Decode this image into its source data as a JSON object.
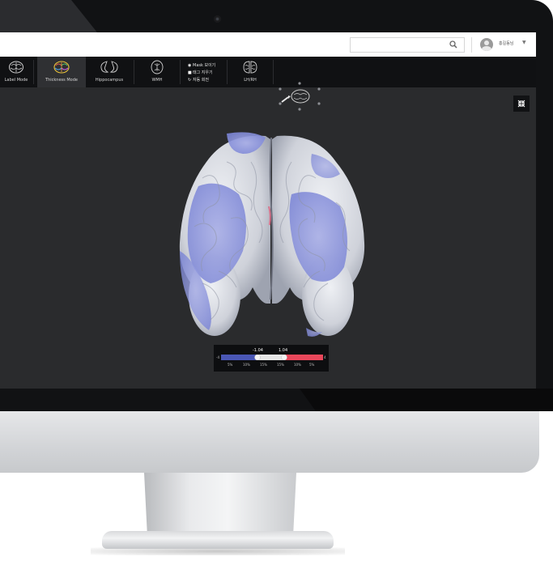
{
  "header": {
    "search_placeholder": "",
    "user_name": "홍길동님"
  },
  "toolbar": {
    "tools": [
      {
        "label": "Label Mode"
      },
      {
        "label": "Thickness Mode"
      },
      {
        "label": "Hippocampus"
      },
      {
        "label": "WMH"
      },
      {
        "label": "LH/RH"
      }
    ],
    "options": [
      {
        "icon": "eye-icon",
        "label": "Mask 보이기"
      },
      {
        "icon": "trash-icon",
        "label": "태그 지우기"
      },
      {
        "icon": "rotate-icon",
        "label": "자동 회전"
      }
    ]
  },
  "legend": {
    "left_value": "-1.04",
    "right_value": "1.04",
    "min_label": "-4",
    "max_label": "4",
    "ticks": [
      "5%",
      "10%",
      "15%",
      "15%",
      "10%",
      "5%"
    ],
    "colors": {
      "negative": "#4a57b5",
      "neutral": "#e6e6e6",
      "positive": "#e8475b"
    }
  },
  "colors": {
    "screen_bg": "#2a2b2d",
    "toolbar_bg": "#101113",
    "active_tool_bg": "#2f3033"
  }
}
